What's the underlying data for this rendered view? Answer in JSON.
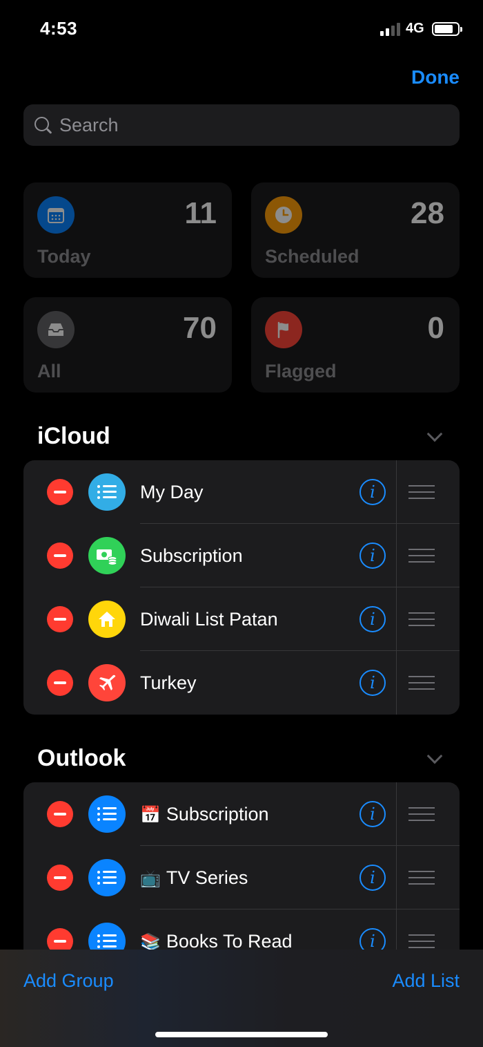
{
  "status": {
    "time": "4:53",
    "network": "4G"
  },
  "header": {
    "done_label": "Done"
  },
  "search": {
    "placeholder": "Search"
  },
  "smart_lists": [
    {
      "label": "Today",
      "count": "11",
      "icon": "calendar-icon",
      "color": "#0a84ff"
    },
    {
      "label": "Scheduled",
      "count": "28",
      "icon": "clock-icon",
      "color": "#ff9f0a"
    },
    {
      "label": "All",
      "count": "70",
      "icon": "tray-icon",
      "color": "#636366"
    },
    {
      "label": "Flagged",
      "count": "0",
      "icon": "flag-icon",
      "color": "#ff453a"
    }
  ],
  "groups": [
    {
      "title": "iCloud",
      "lists": [
        {
          "label": "My Day",
          "icon": "list-bullet-icon",
          "color": "#32ade6"
        },
        {
          "label": "Subscription",
          "icon": "money-icon",
          "color": "#30d158"
        },
        {
          "label": "Diwali List Patan",
          "icon": "house-icon",
          "color": "#ffd60a"
        },
        {
          "label": "Turkey",
          "icon": "airplane-icon",
          "color": "#ff453a"
        }
      ]
    },
    {
      "title": "Outlook",
      "lists": [
        {
          "emoji": "📅",
          "label": "Subscription",
          "icon": "list-bullet-icon",
          "color": "#0a84ff"
        },
        {
          "emoji": "📺",
          "label": "TV Series",
          "icon": "list-bullet-icon",
          "color": "#0a84ff"
        },
        {
          "emoji": "📚",
          "label": "Books To Read",
          "icon": "list-bullet-icon",
          "color": "#0a84ff"
        }
      ]
    }
  ],
  "toolbar": {
    "add_group_label": "Add Group",
    "add_list_label": "Add List"
  }
}
